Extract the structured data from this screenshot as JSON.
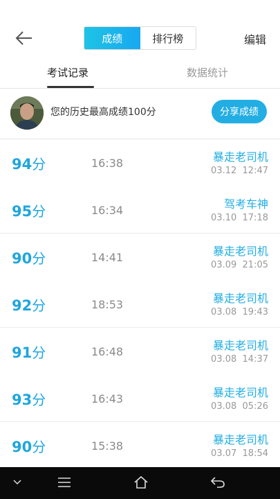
{
  "header": {
    "segments": [
      "成绩",
      "排行榜"
    ],
    "edit_label": "编辑"
  },
  "tabs": [
    "考试记录",
    "数据统计"
  ],
  "best": {
    "text": "您的历史最高成绩100分",
    "share_label": "分享成绩"
  },
  "records": [
    {
      "score": "94",
      "unit": "分",
      "duration": "16:38",
      "nick": "暴走老司机",
      "date": "03.12  12:47"
    },
    {
      "score": "95",
      "unit": "分",
      "duration": "16:34",
      "nick": "驾考车神",
      "date": "03.10  17:18"
    },
    {
      "score": "90",
      "unit": "分",
      "duration": "14:41",
      "nick": "暴走老司机",
      "date": "03.09  21:05"
    },
    {
      "score": "92",
      "unit": "分",
      "duration": "18:53",
      "nick": "暴走老司机",
      "date": "03.08  19:43"
    },
    {
      "score": "91",
      "unit": "分",
      "duration": "16:48",
      "nick": "暴走老司机",
      "date": "03.08  14:37"
    },
    {
      "score": "93",
      "unit": "分",
      "duration": "16:43",
      "nick": "暴走老司机",
      "date": "03.08  05:26"
    },
    {
      "score": "90",
      "unit": "分",
      "duration": "15:38",
      "nick": "暴走老司机",
      "date": "03.07  18:54"
    }
  ],
  "colors": {
    "accent": "#23aee3",
    "score": "#1fa6de"
  },
  "navbar_icons": [
    "chevron-down-icon",
    "menu-icon",
    "home-icon",
    "back-icon"
  ]
}
